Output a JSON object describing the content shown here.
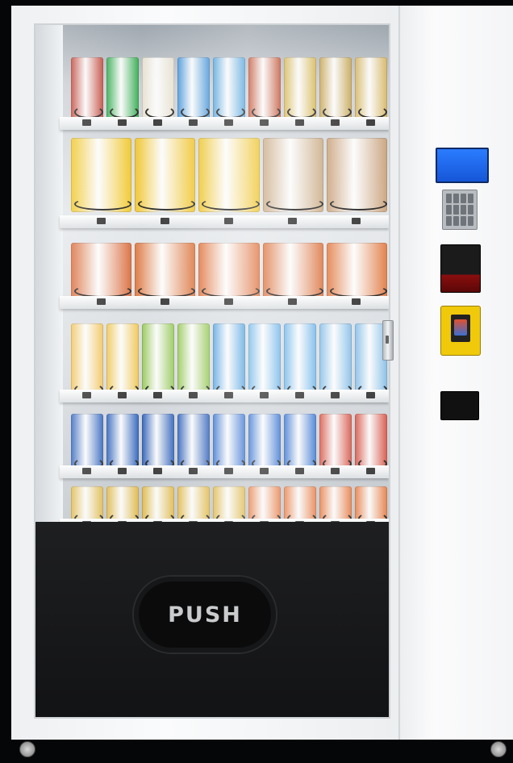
{
  "door": {
    "push_label": "PUSH"
  },
  "colors": {
    "cabinet": "#f6f7f8",
    "bin": "#121315",
    "lcd": "#1656d8",
    "coin_unit": "#f0c90b",
    "bill_acceptor_accent": "#8a0e0e"
  },
  "rows": [
    {
      "name": "row-1-snacks",
      "products": [
        {
          "color": "#c0392b"
        },
        {
          "color": "#27a844"
        },
        {
          "color": "#e8e1cf"
        },
        {
          "color": "#3b8fd8"
        },
        {
          "color": "#4aa0dd"
        },
        {
          "color": "#c24a2a"
        },
        {
          "color": "#d6b44a"
        },
        {
          "color": "#c6a24a"
        },
        {
          "color": "#d8b55c"
        }
      ]
    },
    {
      "name": "row-2-chips",
      "products": [
        {
          "color": "#f2c417"
        },
        {
          "color": "#f1c21a"
        },
        {
          "color": "#f0c31d"
        },
        {
          "color": "#c9a67c"
        },
        {
          "color": "#c79d72"
        }
      ]
    },
    {
      "name": "row-3-noodles",
      "products": [
        {
          "color": "#d9602a"
        },
        {
          "color": "#db6a2c"
        },
        {
          "color": "#e06b31"
        },
        {
          "color": "#dc6a31"
        },
        {
          "color": "#e27236"
        }
      ]
    },
    {
      "name": "row-4-bottles",
      "products": [
        {
          "color": "#f3c04a"
        },
        {
          "color": "#f1c447"
        },
        {
          "color": "#8fc54a"
        },
        {
          "color": "#8fc54a"
        },
        {
          "color": "#4a9ee0"
        },
        {
          "color": "#67b2ea"
        },
        {
          "color": "#67b2ea"
        },
        {
          "color": "#7dbbe8"
        },
        {
          "color": "#7dbbe8"
        }
      ]
    },
    {
      "name": "row-5-cans",
      "products": [
        {
          "color": "#1f57b8"
        },
        {
          "color": "#1f57b8"
        },
        {
          "color": "#1d54b5"
        },
        {
          "color": "#1d54b5"
        },
        {
          "color": "#2a6bd0"
        },
        {
          "color": "#2a6bd0"
        },
        {
          "color": "#2a6bd0"
        },
        {
          "color": "#d84a3a"
        },
        {
          "color": "#d84a3a"
        }
      ]
    },
    {
      "name": "row-6-cans",
      "products": [
        {
          "color": "#e0b63c"
        },
        {
          "color": "#e0b63c"
        },
        {
          "color": "#e0b63c"
        },
        {
          "color": "#e0b63c"
        },
        {
          "color": "#e0b63c"
        },
        {
          "color": "#e9783c"
        },
        {
          "color": "#e9783c"
        },
        {
          "color": "#e9783c"
        },
        {
          "color": "#e9783c"
        }
      ]
    }
  ]
}
